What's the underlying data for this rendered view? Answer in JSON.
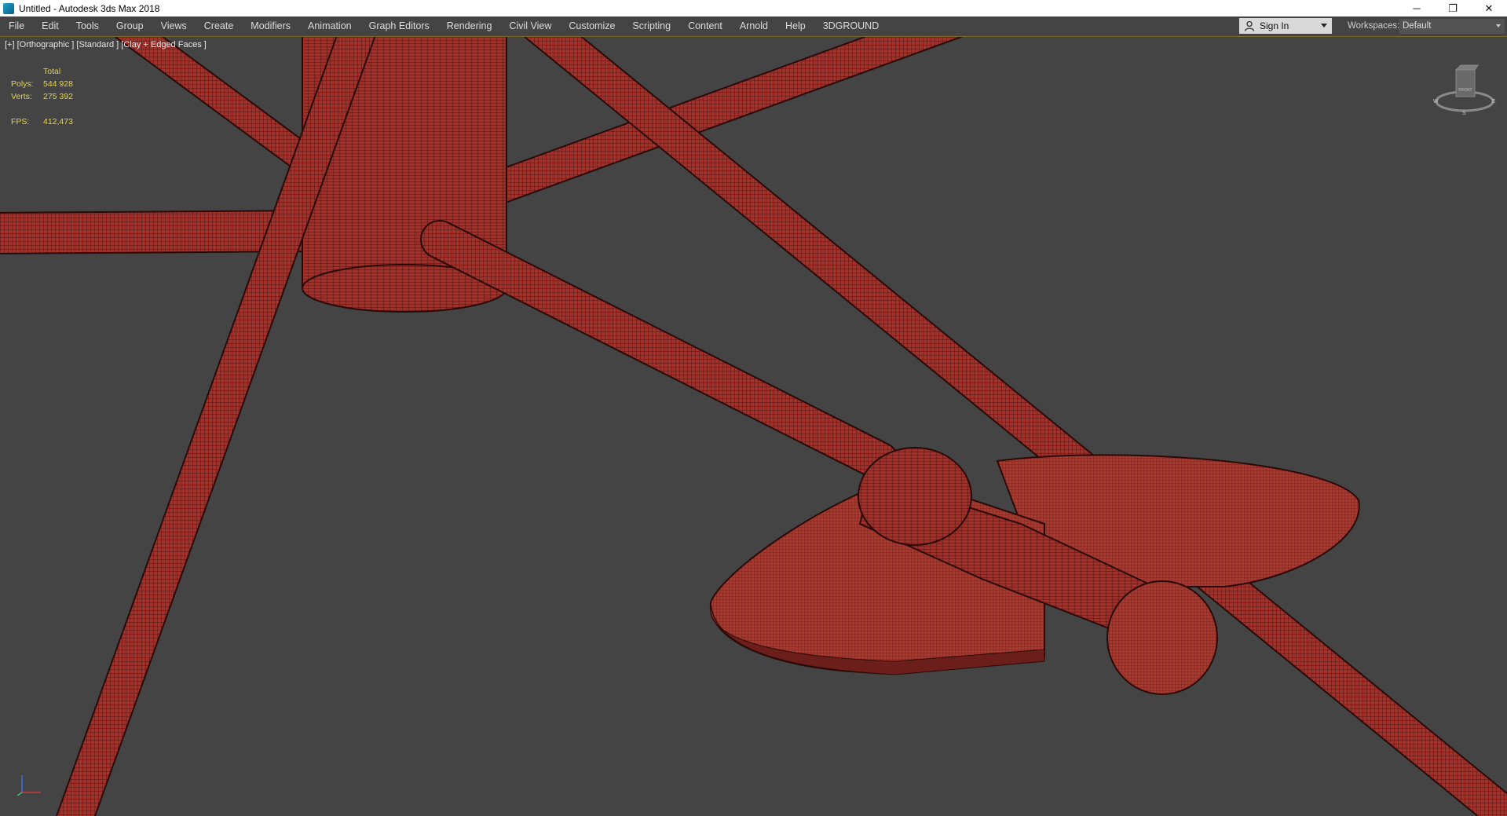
{
  "window": {
    "title": "Untitled - Autodesk 3ds Max 2018",
    "controls": {
      "minimize": "─",
      "restore": "❐",
      "close": "✕"
    }
  },
  "menubar": {
    "items": [
      "File",
      "Edit",
      "Tools",
      "Group",
      "Views",
      "Create",
      "Modifiers",
      "Animation",
      "Graph Editors",
      "Rendering",
      "Civil View",
      "Customize",
      "Scripting",
      "Content",
      "Arnold",
      "Help",
      "3DGROUND"
    ],
    "sign_in": "Sign In",
    "workspaces_label": "Workspaces:",
    "workspace_value": "Default"
  },
  "viewport": {
    "label": "[+] [Orthographic ] [Standard ] [Clay + Edged Faces ]",
    "stats": {
      "header": "Total",
      "polys_label": "Polys:",
      "polys_value": "544 928",
      "verts_label": "Verts:",
      "verts_value": "275 392",
      "fps_label": "FPS:",
      "fps_value": "412,473"
    },
    "viewcube": {
      "face": "FRONT",
      "compass": {
        "w": "W",
        "e": "E",
        "s": "S"
      }
    },
    "model_color": "#9b2f2a",
    "background_color": "#444444"
  }
}
